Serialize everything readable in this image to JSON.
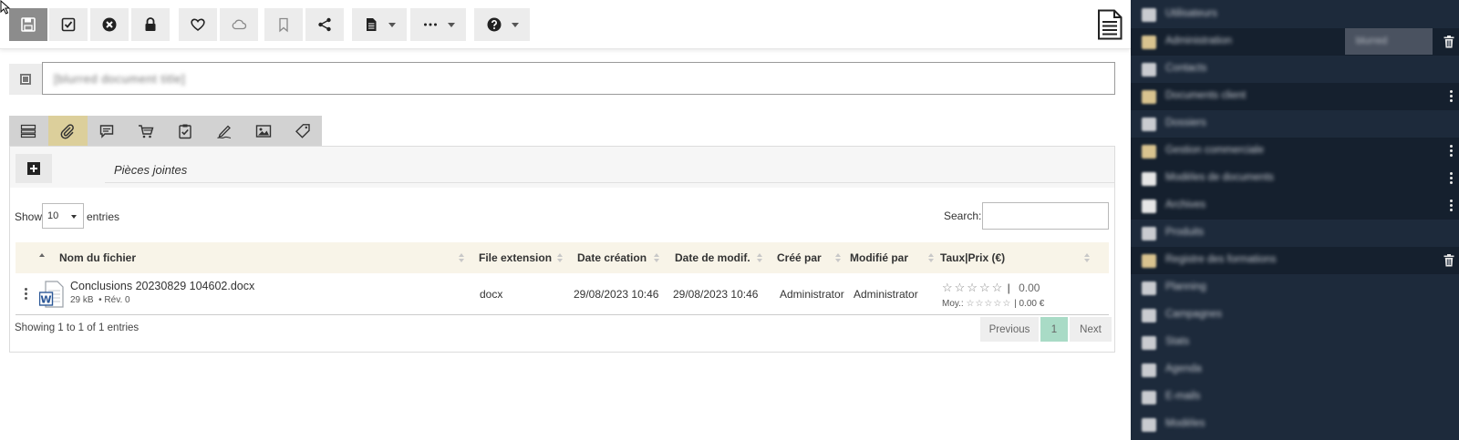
{
  "toolbar": {
    "buttons": [
      {
        "name": "save-button",
        "icon": "floppy-disk-icon"
      },
      {
        "name": "validate-button",
        "icon": "checkbox-icon"
      },
      {
        "name": "close-button",
        "icon": "circle-x-icon"
      },
      {
        "name": "lock-button",
        "icon": "lock-icon"
      },
      {
        "name": "favorite-button",
        "icon": "heart-icon"
      },
      {
        "name": "cloud-button",
        "icon": "cloud-icon"
      },
      {
        "name": "bookmark-button",
        "icon": "bookmark-icon"
      },
      {
        "name": "share-button",
        "icon": "share-icon"
      },
      {
        "name": "document-menu-button",
        "icon": "document-icon"
      },
      {
        "name": "more-menu-button",
        "icon": "ellipsis-icon"
      },
      {
        "name": "help-menu-button",
        "icon": "question-icon"
      }
    ],
    "right_icon": "document-lines-icon"
  },
  "title": {
    "value": "[blurred document title]"
  },
  "tabs": [
    {
      "name": "tab-fields",
      "icon": "fields-icon"
    },
    {
      "name": "tab-attachments",
      "icon": "paperclip-icon",
      "active": true
    },
    {
      "name": "tab-comments",
      "icon": "comment-icon"
    },
    {
      "name": "tab-cart",
      "icon": "cart-icon"
    },
    {
      "name": "tab-tasks",
      "icon": "clipboard-check-icon"
    },
    {
      "name": "tab-signature",
      "icon": "pen-icon"
    },
    {
      "name": "tab-images",
      "icon": "image-icon"
    },
    {
      "name": "tab-tags",
      "icon": "tag-icon"
    }
  ],
  "attachments": {
    "section_title": "Pièces jointes",
    "show_label": "Show",
    "page_length": "10",
    "entries_label": "entries",
    "search_label": "Search:",
    "search_value": "",
    "columns": [
      "Nom du fichier",
      "File extension",
      "Date création",
      "Date de modif.",
      "Créé par",
      "Modifié par",
      "Taux|Prix (€)"
    ],
    "rows": [
      {
        "file_name": "Conclusions 20230829 104602.docx",
        "size": "29 kB",
        "revision": "• Rév. 0",
        "extension": "docx",
        "created": "29/08/2023 10:46",
        "modified": "29/08/2023 10:46",
        "created_by": "Administrator",
        "modified_by": "Administrator",
        "rating": 0,
        "rating_stars": "☆☆☆☆☆",
        "rating_sep": "|",
        "price": "0.00",
        "avg_label": "Moy.:",
        "avg_stars": "☆☆☆☆☆",
        "avg_price": "| 0.00 €"
      }
    ],
    "info": "Showing 1 to 1 of 1 entries",
    "pager": {
      "previous": "Previous",
      "current": "1",
      "next": "Next"
    }
  },
  "sidebar": {
    "items": [
      {
        "label": "Utilisateurs",
        "icon_color": "#c9cbd0",
        "action": ""
      },
      {
        "label": "Administration",
        "icon_color": "#d9c38f",
        "action": "trash",
        "highlight": true
      },
      {
        "label": "Contacts",
        "icon_color": "#c9cbd0",
        "action": ""
      },
      {
        "label": "Documents client",
        "icon_color": "#d9c38f",
        "action": "kebab",
        "highlight": true
      },
      {
        "label": "Dossiers",
        "icon_color": "#c9cbd0",
        "action": ""
      },
      {
        "label": "Gestion commerciale",
        "icon_color": "#d9c38f",
        "action": "kebab",
        "highlight": true
      },
      {
        "label": "Modèles de documents",
        "icon_color": "#e6e6e6",
        "action": "kebab",
        "highlight": true
      },
      {
        "label": "Archives",
        "icon_color": "#e6e6e6",
        "action": "kebab",
        "highlight": true
      },
      {
        "label": "Produits",
        "icon_color": "#c9cbd0",
        "action": ""
      },
      {
        "label": "Registre des formations",
        "icon_color": "#d9c38f",
        "action": "trash",
        "highlight": true
      },
      {
        "label": "Planning",
        "icon_color": "#c9cbd0",
        "action": ""
      },
      {
        "label": "Campagnes",
        "icon_color": "#c9cbd0",
        "action": ""
      },
      {
        "label": "Stats",
        "icon_color": "#c9cbd0",
        "action": ""
      },
      {
        "label": "Agenda",
        "icon_color": "#c9cbd0",
        "action": ""
      },
      {
        "label": "E-mails",
        "icon_color": "#c9cbd0",
        "action": ""
      },
      {
        "label": "Modèles",
        "icon_color": "#c9cbd0",
        "action": ""
      }
    ],
    "pill_text": "blurred"
  }
}
